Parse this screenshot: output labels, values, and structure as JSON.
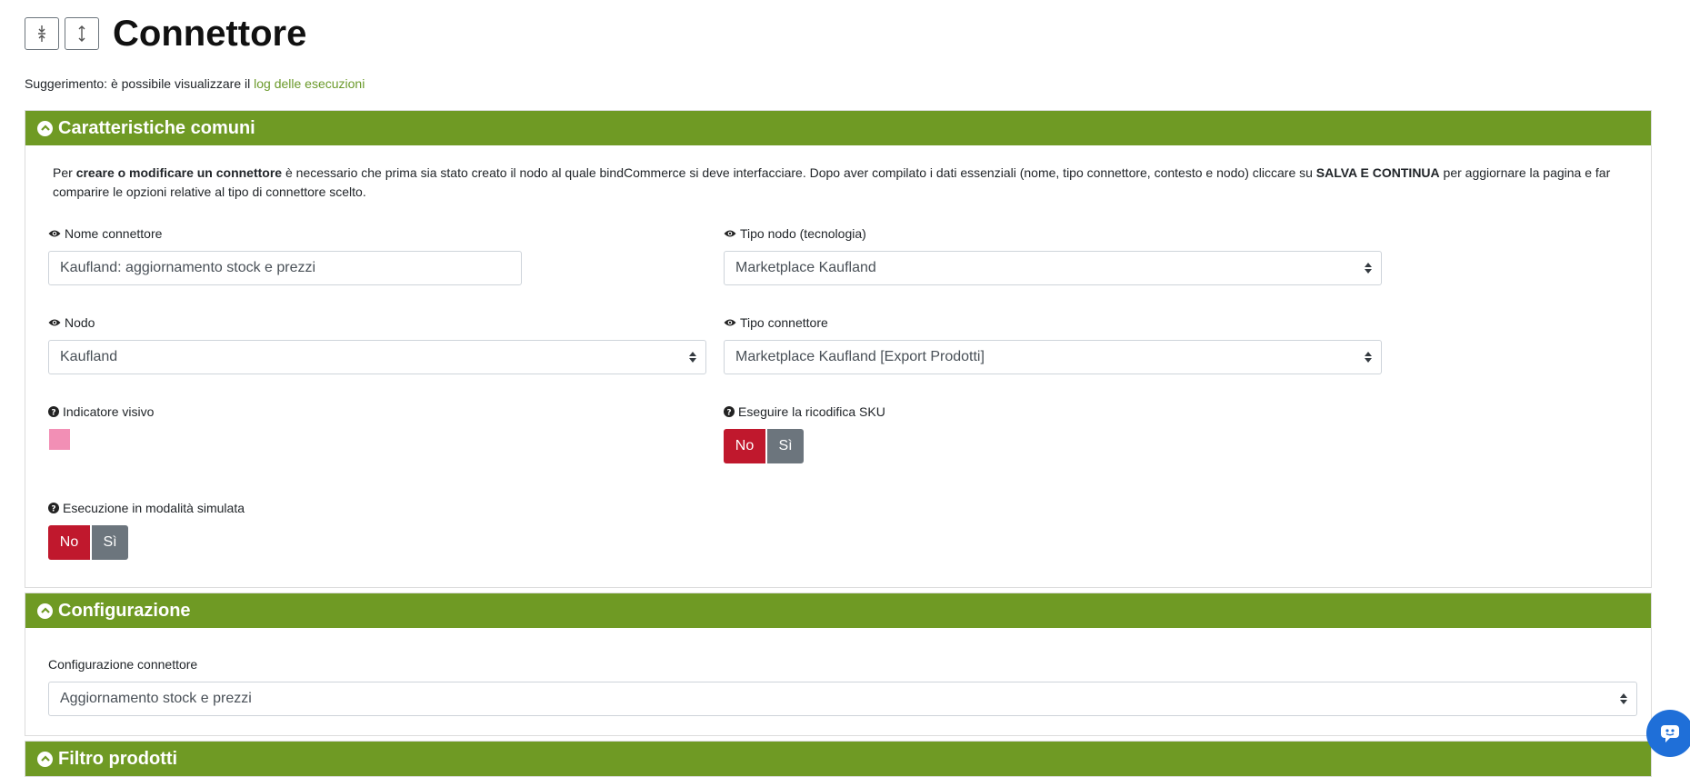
{
  "page": {
    "title": "Connettore",
    "collapse_all_icon": "collapse-arrows-icon",
    "expand_all_icon": "expand-arrows-icon"
  },
  "tip": {
    "prefix": "Suggerimento: è possibile visualizzare il ",
    "link": "log delle esecuzioni"
  },
  "colors": {
    "accent": "#6f9a24",
    "danger": "#c0182d",
    "secondary": "#6c757d",
    "swatch": "#f28fb5",
    "link": "#6b9a2b"
  },
  "common": {
    "header": "Caratteristiche comuni",
    "desc": {
      "p1": "Per ",
      "b1": "creare o modificare un connettore",
      "p2": " è necessario che prima sia stato creato il nodo al quale bindCommerce si deve interfacciare. Dopo aver compilato i dati essenziali (nome, tipo connettore, contesto e nodo) cliccare su ",
      "b2": "SALVA E CONTINUA",
      "p3": " per aggiornare la pagina e far comparire le opzioni relative al tipo di connettore scelto."
    },
    "nome_label": "Nome connettore",
    "nome_value": "Kaufland: aggiornamento stock e prezzi",
    "tipo_nodo_label": "Tipo nodo (tecnologia)",
    "tipo_nodo_value": "Marketplace Kaufland",
    "nodo_label": "Nodo",
    "nodo_value": "Kaufland",
    "tipo_connettore_label": "Tipo connettore",
    "tipo_connettore_value": "Marketplace Kaufland [Export Prodotti]",
    "indicatore_label": "Indicatore visivo",
    "sku_label": "Eseguire la ricodifica SKU",
    "sku_no": "No",
    "sku_si": "Sì",
    "sim_label": "Esecuzione in modalità simulata",
    "sim_no": "No",
    "sim_si": "Sì"
  },
  "config": {
    "header": "Configurazione",
    "label": "Configurazione connettore",
    "value": "Aggiornamento stock e prezzi"
  },
  "filtro": {
    "header": "Filtro prodotti"
  }
}
